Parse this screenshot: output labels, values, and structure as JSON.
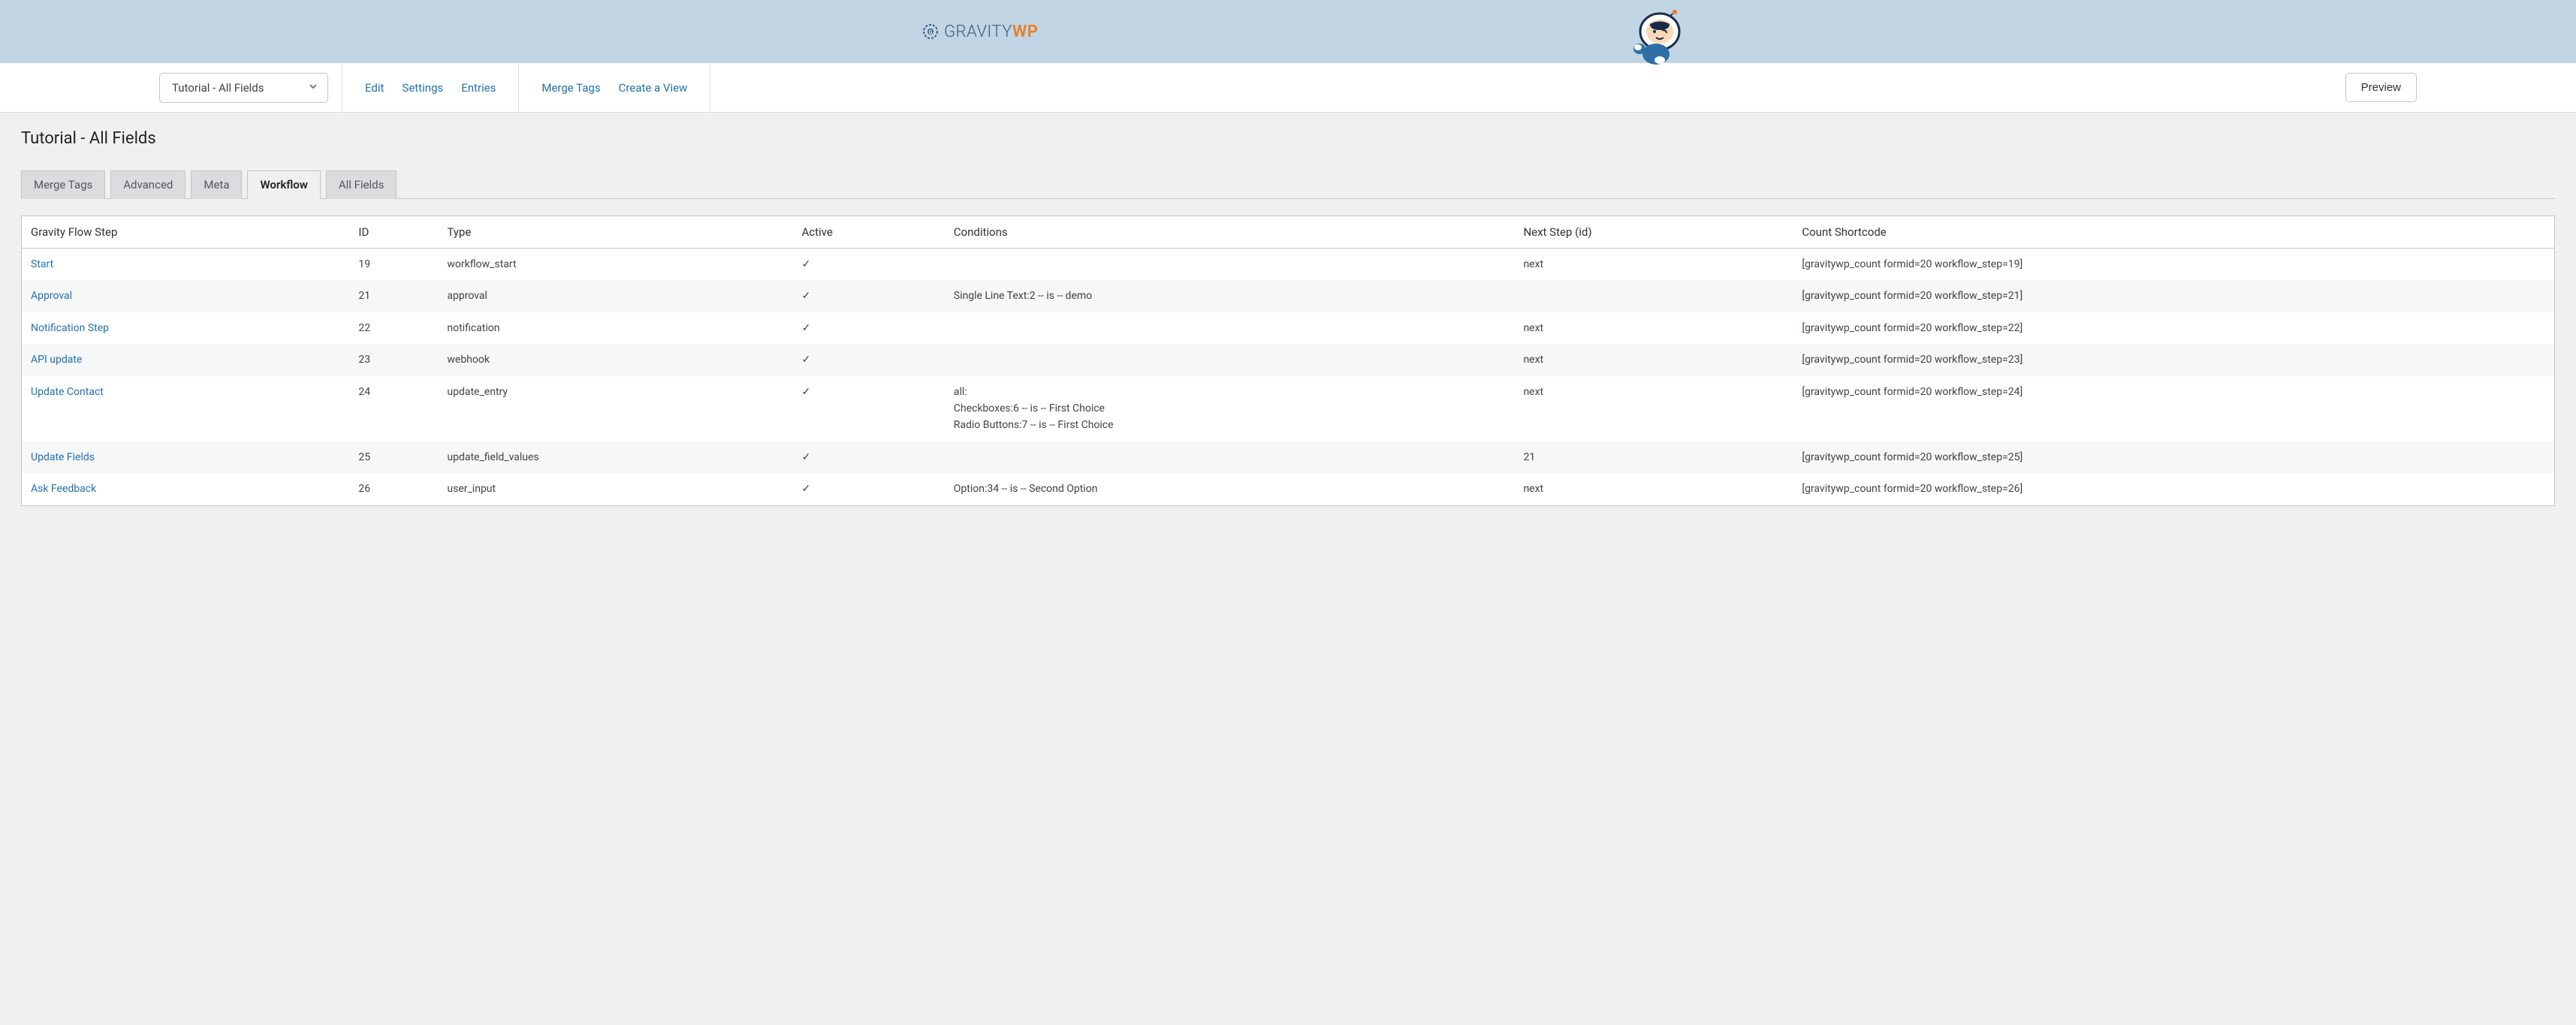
{
  "logo": {
    "text_gravity": "GRAVITY",
    "text_wp": "WP"
  },
  "toolbar": {
    "form_selector": "Tutorial - All Fields",
    "links": [
      "Edit",
      "Settings",
      "Entries"
    ],
    "links2": [
      "Merge Tags",
      "Create a View"
    ],
    "preview": "Preview"
  },
  "page": {
    "title": "Tutorial - All Fields"
  },
  "tabs": [
    {
      "label": "Merge Tags",
      "active": false
    },
    {
      "label": "Advanced",
      "active": false
    },
    {
      "label": "Meta",
      "active": false
    },
    {
      "label": "Workflow",
      "active": true
    },
    {
      "label": "All Fields",
      "active": false
    }
  ],
  "table": {
    "headers": [
      "Gravity Flow Step",
      "ID",
      "Type",
      "Active",
      "Conditions",
      "Next Step (id)",
      "Count Shortcode"
    ],
    "rows": [
      {
        "step": "Start",
        "id": "19",
        "type": "workflow_start",
        "active": "✓",
        "conditions": "",
        "next": "next",
        "shortcode": "[gravitywp_count formid=20 workflow_step=19]"
      },
      {
        "step": "Approval",
        "id": "21",
        "type": "approval",
        "active": "✓",
        "conditions": "Single Line Text:2 -- is -- demo",
        "next": "",
        "shortcode": "[gravitywp_count formid=20 workflow_step=21]"
      },
      {
        "step": "Notification Step",
        "id": "22",
        "type": "notification",
        "active": "✓",
        "conditions": "",
        "next": "next",
        "shortcode": "[gravitywp_count formid=20 workflow_step=22]"
      },
      {
        "step": "API update",
        "id": "23",
        "type": "webhook",
        "active": "✓",
        "conditions": "",
        "next": "next",
        "shortcode": "[gravitywp_count formid=20 workflow_step=23]"
      },
      {
        "step": "Update Contact",
        "id": "24",
        "type": "update_entry",
        "active": "✓",
        "conditions": "all:\nCheckboxes:6 -- is -- First Choice\nRadio Buttons:7 -- is -- First Choice",
        "next": "next",
        "shortcode": "[gravitywp_count formid=20 workflow_step=24]"
      },
      {
        "step": "Update Fields",
        "id": "25",
        "type": "update_field_values",
        "active": "✓",
        "conditions": "",
        "next": "21",
        "shortcode": "[gravitywp_count formid=20 workflow_step=25]"
      },
      {
        "step": "Ask Feedback",
        "id": "26",
        "type": "user_input",
        "active": "✓",
        "conditions": "Option:34 -- is -- Second Option",
        "next": "next",
        "shortcode": "[gravitywp_count formid=20 workflow_step=26]"
      }
    ]
  }
}
